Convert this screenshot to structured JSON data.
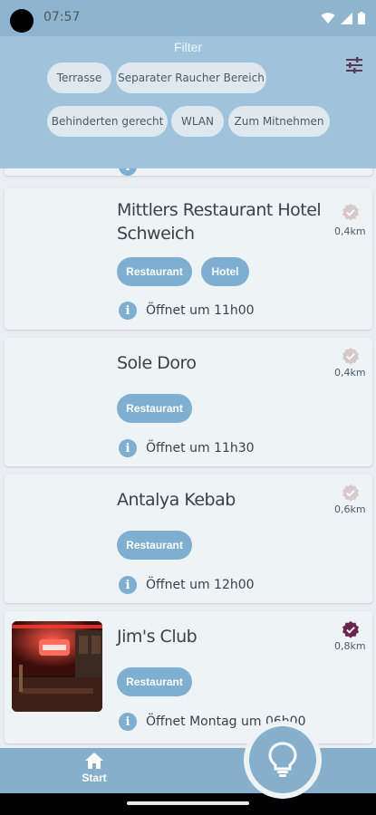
{
  "status_bar": {
    "time": "07:57"
  },
  "filter": {
    "title": "Filter",
    "chips": [
      {
        "label": "Terrasse"
      },
      {
        "label": "Separater Raucher Bereich"
      },
      {
        "label": "Behinderten gerecht"
      },
      {
        "label": "WLAN"
      },
      {
        "label": "Zum Mitnehmen"
      }
    ]
  },
  "restaurants": [
    {
      "name_line1": "Mittlers Restaurant Hotel",
      "name_line2": "Schweich",
      "tags": [
        "Restaurant",
        "Hotel"
      ],
      "hours": "Öffnet um 11h00",
      "distance": "0,4km",
      "verified": false
    },
    {
      "name_line1": "Sole Doro",
      "tags": [
        "Restaurant"
      ],
      "hours": "Öffnet um 11h30",
      "distance": "0,4km",
      "verified": false
    },
    {
      "name_line1": "Antalya Kebab",
      "tags": [
        "Restaurant"
      ],
      "hours": "Öffnet um 12h00",
      "distance": "0,6km",
      "verified": false
    },
    {
      "name_line1": "Jim's Club",
      "tags": [
        "Restaurant"
      ],
      "hours": "Öffnet Montag um 06h00",
      "distance": "0,8km",
      "verified": true
    }
  ],
  "bottom_nav": {
    "start_label": "Start"
  },
  "colors": {
    "accent": "#7eaed0",
    "header": "#9fc3da",
    "verified_active": "#6b2450",
    "verified_inactive": "#d6c9c9"
  }
}
